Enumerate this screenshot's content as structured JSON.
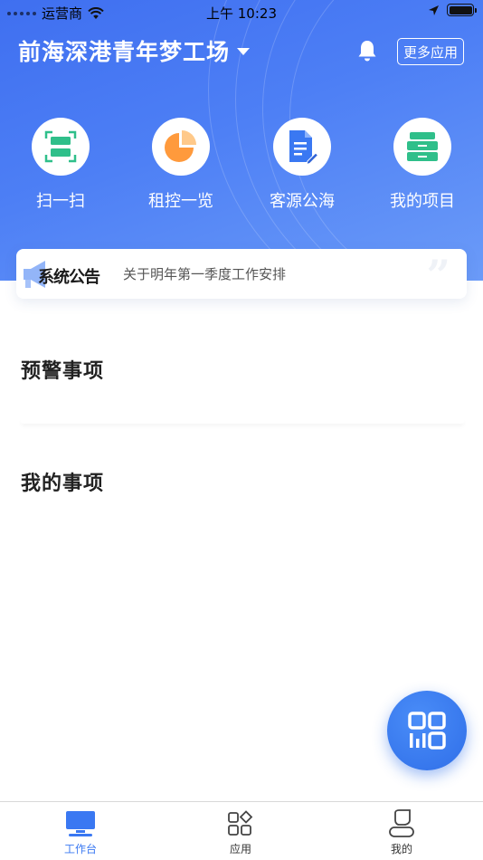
{
  "status_bar": {
    "carrier": "运营商",
    "time": "上午 10:23"
  },
  "header": {
    "title": "前海深港青年梦工场",
    "more_apps": "更多应用"
  },
  "quick_actions": [
    {
      "label": "扫一扫",
      "icon": "scan-icon",
      "color": "#2fbf8a"
    },
    {
      "label": "租控一览",
      "icon": "pie-chart-icon",
      "color": "#ff9a3c"
    },
    {
      "label": "客源公海",
      "icon": "document-edit-icon",
      "color": "#3a78f2"
    },
    {
      "label": "我的项目",
      "icon": "cabinet-icon",
      "color": "#2fbf8a"
    }
  ],
  "notice": {
    "brand": "系统公告",
    "text": "关于明年第一季度工作安排"
  },
  "sections": {
    "warnings": "预警事项",
    "my_items": "我的事项"
  },
  "tabbar": {
    "tabs": [
      {
        "label": "工作台",
        "icon": "monitor-icon"
      },
      {
        "label": "应用",
        "icon": "apps-grid-icon"
      },
      {
        "label": "我的",
        "icon": "profile-icon"
      }
    ],
    "active_index": 0
  },
  "colors": {
    "primary": "#3a78f2",
    "header_start": "#3f6ff0",
    "header_end": "#6b9bf8"
  }
}
